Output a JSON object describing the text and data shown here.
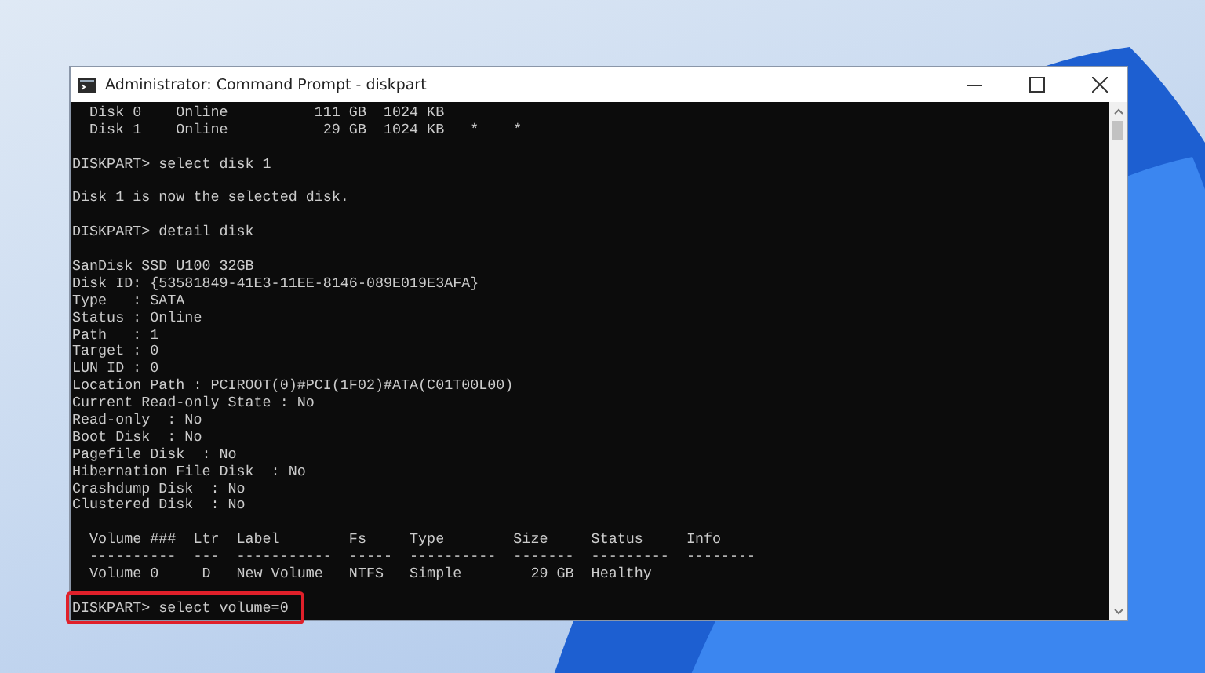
{
  "window": {
    "title": "Administrator: Command Prompt - diskpart"
  },
  "console": {
    "blocks": [
      {
        "highlighted": false,
        "lines": [
          "  Disk 0    Online          111 GB  1024 KB",
          "  Disk 1    Online           29 GB  1024 KB   *    *"
        ]
      },
      {
        "highlighted": false,
        "lines": [
          "DISKPART> select disk 1"
        ]
      },
      {
        "highlighted": false,
        "lines": [
          "Disk 1 is now the selected disk."
        ]
      },
      {
        "highlighted": false,
        "lines": [
          "DISKPART> detail disk"
        ]
      },
      {
        "highlighted": false,
        "lines": [
          "SanDisk SSD U100 32GB",
          "Disk ID: {53581849-41E3-11EE-8146-089E019E3AFA}",
          "Type   : SATA",
          "Status : Online",
          "Path   : 1",
          "Target : 0",
          "LUN ID : 0",
          "Location Path : PCIROOT(0)#PCI(1F02)#ATA(C01T00L00)",
          "Current Read-only State : No",
          "Read-only  : No",
          "Boot Disk  : No",
          "Pagefile Disk  : No",
          "Hibernation File Disk  : No",
          "Crashdump Disk  : No",
          "Clustered Disk  : No"
        ]
      },
      {
        "highlighted": false,
        "lines": [
          "  Volume ###  Ltr  Label        Fs     Type        Size     Status     Info",
          "  ----------  ---  -----------  -----  ----------  -------  ---------  --------",
          "  Volume 0     D   New Volume   NTFS   Simple        29 GB  Healthy"
        ]
      },
      {
        "highlighted": true,
        "lines": [
          "DISKPART> select volume=0"
        ]
      }
    ]
  }
}
